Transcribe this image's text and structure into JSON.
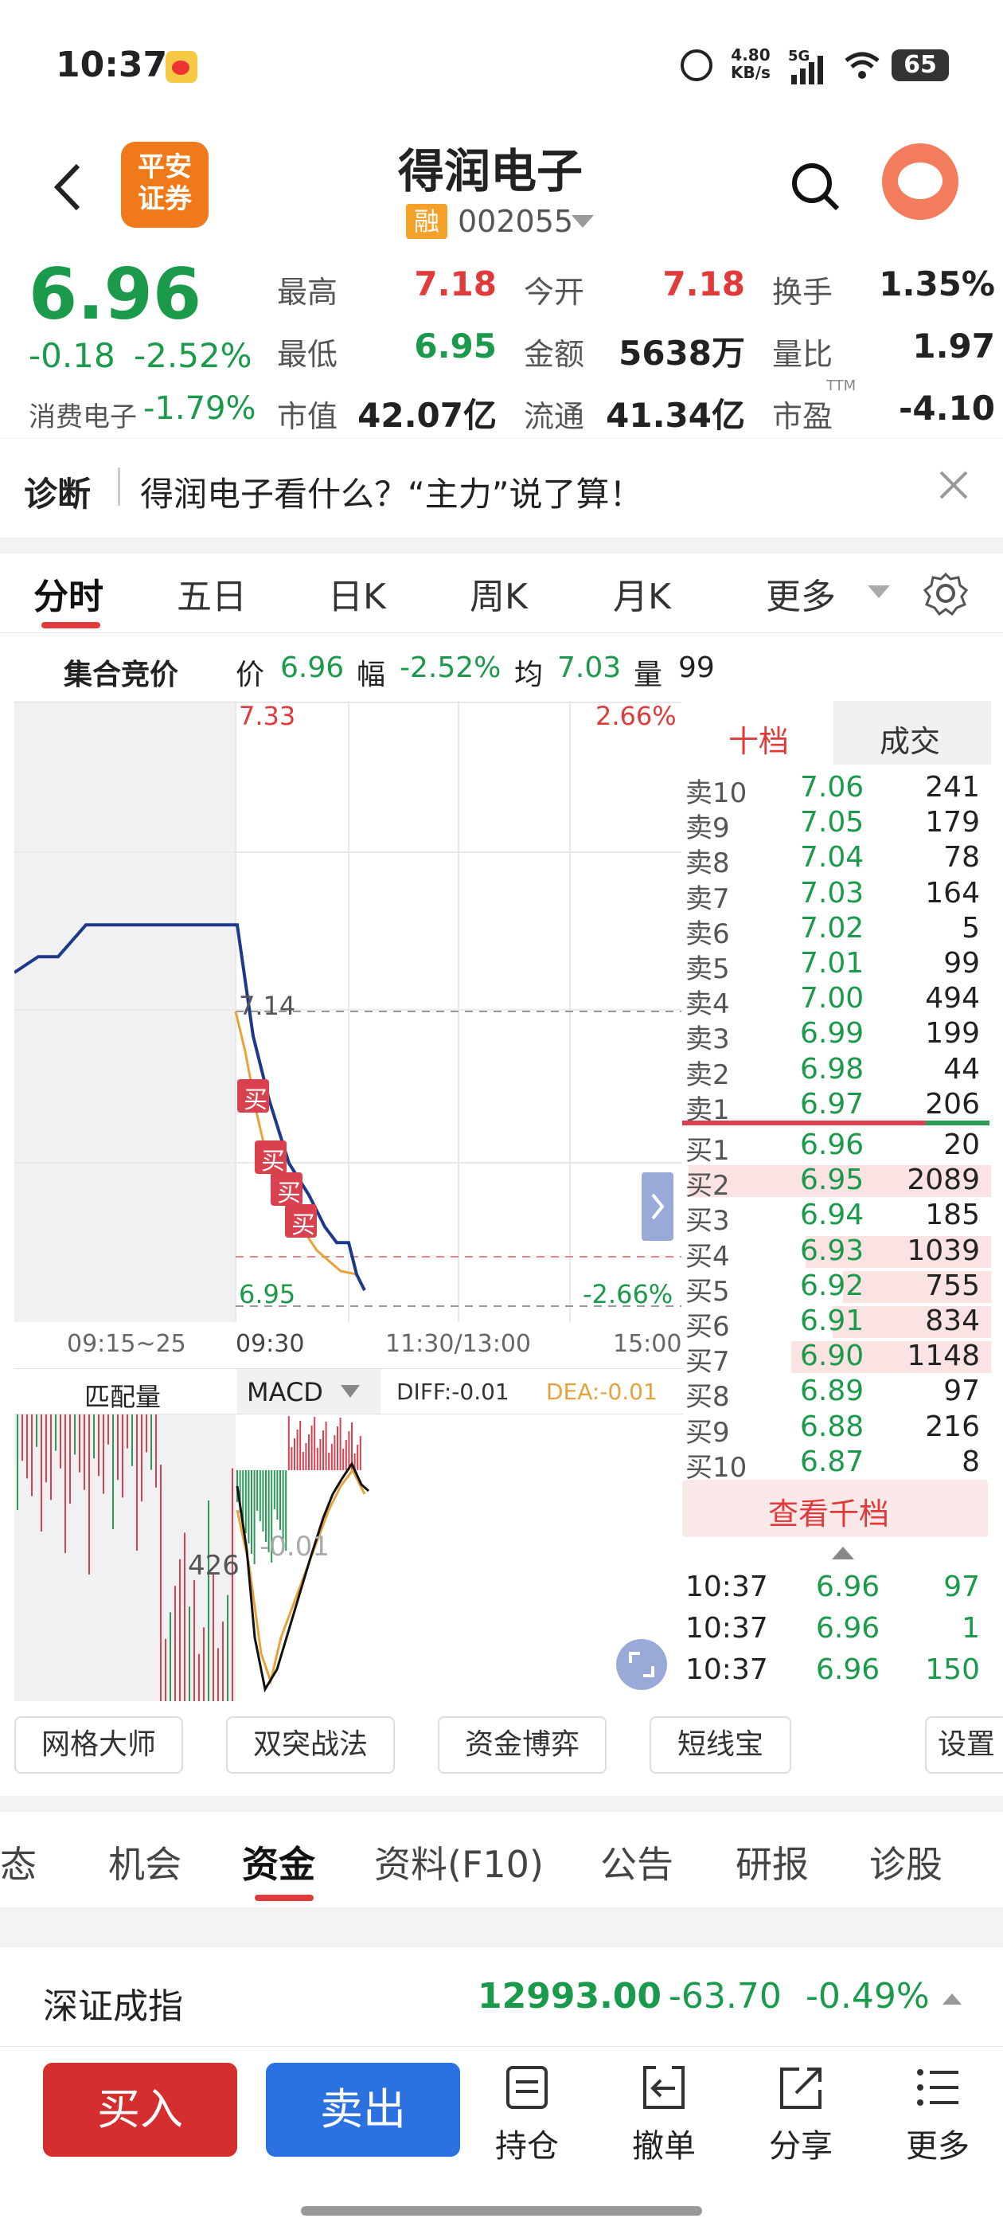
{
  "status": {
    "time": "10:37",
    "net_speed_top": "4.80",
    "net_speed_unit": "KB/s",
    "network": "5G",
    "battery": "65"
  },
  "header": {
    "broker_logo": "平安\n证券",
    "stock_name": "得润电子",
    "margin_badge": "融",
    "stock_code": "002055"
  },
  "quote": {
    "price": "6.96",
    "change": "-0.18",
    "change_pct": "-2.52%",
    "sector": "消费电子",
    "sector_pct": "-1.79%",
    "rows": [
      [
        {
          "label": "最高",
          "value": "7.18",
          "color": "red"
        },
        {
          "label": "今开",
          "value": "7.18",
          "color": "red"
        },
        {
          "label": "换手",
          "value": "1.35%",
          "color": "black"
        }
      ],
      [
        {
          "label": "最低",
          "value": "6.95",
          "color": "green"
        },
        {
          "label": "金额",
          "value": "5638万",
          "color": "black"
        },
        {
          "label": "量比",
          "value": "1.97",
          "color": "black"
        }
      ],
      [
        {
          "label": "市值",
          "value": "42.07亿",
          "color": "black"
        },
        {
          "label": "流通",
          "value": "41.34亿",
          "color": "black"
        },
        {
          "label": "市盈",
          "value": "-4.10",
          "color": "black",
          "sup": "TTM"
        }
      ]
    ]
  },
  "diagnosis": {
    "tag": "诊断",
    "text": "得润电子看什么？“主力”说了算！"
  },
  "tabs": [
    "分时",
    "五日",
    "日K",
    "周K",
    "月K",
    "更多"
  ],
  "auction": {
    "label": "集合竞价",
    "price_label": "价",
    "price": "6.96",
    "range_label": "幅",
    "range": "-2.52%",
    "avg_label": "均",
    "avg": "7.03",
    "vol_label": "量",
    "vol": "99"
  },
  "chart": {
    "y_top": "7.33",
    "y_top_pct": "2.66%",
    "y_mid": "7.14",
    "y_bottom": "6.95",
    "y_bottom_pct": "-2.66%",
    "x_labels": [
      "09:15~25",
      "09:30",
      "11:30/13:00",
      "15:00"
    ],
    "buy_marker": "买",
    "sub_left_label": "匹配量",
    "indicator": "MACD",
    "diff_label": "DIFF:-0.01",
    "dea_label": "DEA:-0.01",
    "vol_label": "426",
    "macd_label": "-0.01"
  },
  "chart_data": {
    "type": "line",
    "x": [
      "09:15",
      "09:17",
      "09:19",
      "09:21",
      "09:23",
      "09:25",
      "09:30",
      "09:33",
      "09:36",
      "09:39",
      "09:42",
      "09:45",
      "09:48",
      "09:51",
      "09:54",
      "09:57"
    ],
    "series": [
      {
        "values": [
          7.16,
          7.17,
          7.17,
          7.19,
          7.19,
          7.19,
          7.19,
          7.12,
          7.08,
          7.04,
          7.02,
          7.0,
          6.99,
          6.99,
          6.97,
          6.96
        ]
      }
    ],
    "ylim": [
      6.95,
      7.33
    ]
  },
  "book": {
    "tab_active": "十档",
    "tab_other": "成交",
    "asks": [
      [
        "卖10",
        "7.06",
        "241"
      ],
      [
        "卖9",
        "7.05",
        "179"
      ],
      [
        "卖8",
        "7.04",
        "78"
      ],
      [
        "卖7",
        "7.03",
        "164"
      ],
      [
        "卖6",
        "7.02",
        "5"
      ],
      [
        "卖5",
        "7.01",
        "99"
      ],
      [
        "卖4",
        "7.00",
        "494"
      ],
      [
        "卖3",
        "6.99",
        "199"
      ],
      [
        "卖2",
        "6.98",
        "44"
      ],
      [
        "卖1",
        "6.97",
        "206"
      ]
    ],
    "bids": [
      [
        "买1",
        "6.96",
        "20"
      ],
      [
        "买2",
        "6.95",
        "2089"
      ],
      [
        "买3",
        "6.94",
        "185"
      ],
      [
        "买4",
        "6.93",
        "1039"
      ],
      [
        "买5",
        "6.92",
        "755"
      ],
      [
        "买6",
        "6.91",
        "834"
      ],
      [
        "买7",
        "6.90",
        "1148"
      ],
      [
        "买8",
        "6.89",
        "97"
      ],
      [
        "买9",
        "6.88",
        "216"
      ],
      [
        "买10",
        "6.87",
        "8"
      ]
    ],
    "more_button": "查看千档",
    "trades": [
      [
        "10:37",
        "6.96",
        "97"
      ],
      [
        "10:37",
        "6.96",
        "1"
      ],
      [
        "10:37",
        "6.96",
        "150"
      ]
    ]
  },
  "tools": [
    "网格大师",
    "双突战法",
    "资金博弈",
    "短线宝",
    "设置"
  ],
  "bottom_tabs": [
    "动态",
    "机会",
    "资金",
    "资料(F10)",
    "公告",
    "研报",
    "诊股"
  ],
  "index": {
    "name": "深证成指",
    "value": "12993.00",
    "change": "-63.70",
    "pct": "-0.49%"
  },
  "actions": {
    "buy": "买入",
    "sell": "卖出",
    "icons": [
      "持仓",
      "撤单",
      "分享",
      "更多"
    ]
  }
}
